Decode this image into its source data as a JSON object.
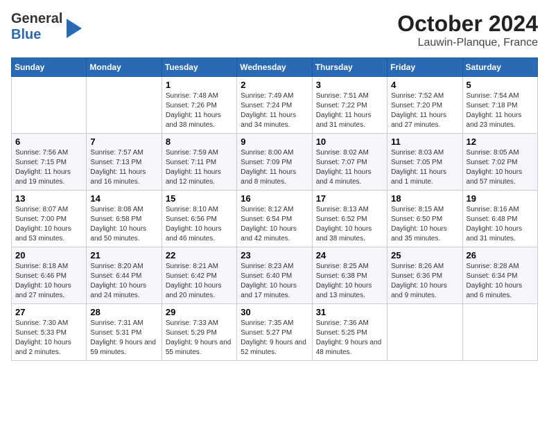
{
  "logo": {
    "general": "General",
    "blue": "Blue"
  },
  "title": "October 2024",
  "subtitle": "Lauwin-Planque, France",
  "days_of_week": [
    "Sunday",
    "Monday",
    "Tuesday",
    "Wednesday",
    "Thursday",
    "Friday",
    "Saturday"
  ],
  "weeks": [
    [
      {
        "day": "",
        "sunrise": "",
        "sunset": "",
        "daylight": ""
      },
      {
        "day": "",
        "sunrise": "",
        "sunset": "",
        "daylight": ""
      },
      {
        "day": "1",
        "sunrise": "Sunrise: 7:48 AM",
        "sunset": "Sunset: 7:26 PM",
        "daylight": "Daylight: 11 hours and 38 minutes."
      },
      {
        "day": "2",
        "sunrise": "Sunrise: 7:49 AM",
        "sunset": "Sunset: 7:24 PM",
        "daylight": "Daylight: 11 hours and 34 minutes."
      },
      {
        "day": "3",
        "sunrise": "Sunrise: 7:51 AM",
        "sunset": "Sunset: 7:22 PM",
        "daylight": "Daylight: 11 hours and 31 minutes."
      },
      {
        "day": "4",
        "sunrise": "Sunrise: 7:52 AM",
        "sunset": "Sunset: 7:20 PM",
        "daylight": "Daylight: 11 hours and 27 minutes."
      },
      {
        "day": "5",
        "sunrise": "Sunrise: 7:54 AM",
        "sunset": "Sunset: 7:18 PM",
        "daylight": "Daylight: 11 hours and 23 minutes."
      }
    ],
    [
      {
        "day": "6",
        "sunrise": "Sunrise: 7:56 AM",
        "sunset": "Sunset: 7:15 PM",
        "daylight": "Daylight: 11 hours and 19 minutes."
      },
      {
        "day": "7",
        "sunrise": "Sunrise: 7:57 AM",
        "sunset": "Sunset: 7:13 PM",
        "daylight": "Daylight: 11 hours and 16 minutes."
      },
      {
        "day": "8",
        "sunrise": "Sunrise: 7:59 AM",
        "sunset": "Sunset: 7:11 PM",
        "daylight": "Daylight: 11 hours and 12 minutes."
      },
      {
        "day": "9",
        "sunrise": "Sunrise: 8:00 AM",
        "sunset": "Sunset: 7:09 PM",
        "daylight": "Daylight: 11 hours and 8 minutes."
      },
      {
        "day": "10",
        "sunrise": "Sunrise: 8:02 AM",
        "sunset": "Sunset: 7:07 PM",
        "daylight": "Daylight: 11 hours and 4 minutes."
      },
      {
        "day": "11",
        "sunrise": "Sunrise: 8:03 AM",
        "sunset": "Sunset: 7:05 PM",
        "daylight": "Daylight: 11 hours and 1 minute."
      },
      {
        "day": "12",
        "sunrise": "Sunrise: 8:05 AM",
        "sunset": "Sunset: 7:02 PM",
        "daylight": "Daylight: 10 hours and 57 minutes."
      }
    ],
    [
      {
        "day": "13",
        "sunrise": "Sunrise: 8:07 AM",
        "sunset": "Sunset: 7:00 PM",
        "daylight": "Daylight: 10 hours and 53 minutes."
      },
      {
        "day": "14",
        "sunrise": "Sunrise: 8:08 AM",
        "sunset": "Sunset: 6:58 PM",
        "daylight": "Daylight: 10 hours and 50 minutes."
      },
      {
        "day": "15",
        "sunrise": "Sunrise: 8:10 AM",
        "sunset": "Sunset: 6:56 PM",
        "daylight": "Daylight: 10 hours and 46 minutes."
      },
      {
        "day": "16",
        "sunrise": "Sunrise: 8:12 AM",
        "sunset": "Sunset: 6:54 PM",
        "daylight": "Daylight: 10 hours and 42 minutes."
      },
      {
        "day": "17",
        "sunrise": "Sunrise: 8:13 AM",
        "sunset": "Sunset: 6:52 PM",
        "daylight": "Daylight: 10 hours and 38 minutes."
      },
      {
        "day": "18",
        "sunrise": "Sunrise: 8:15 AM",
        "sunset": "Sunset: 6:50 PM",
        "daylight": "Daylight: 10 hours and 35 minutes."
      },
      {
        "day": "19",
        "sunrise": "Sunrise: 8:16 AM",
        "sunset": "Sunset: 6:48 PM",
        "daylight": "Daylight: 10 hours and 31 minutes."
      }
    ],
    [
      {
        "day": "20",
        "sunrise": "Sunrise: 8:18 AM",
        "sunset": "Sunset: 6:46 PM",
        "daylight": "Daylight: 10 hours and 27 minutes."
      },
      {
        "day": "21",
        "sunrise": "Sunrise: 8:20 AM",
        "sunset": "Sunset: 6:44 PM",
        "daylight": "Daylight: 10 hours and 24 minutes."
      },
      {
        "day": "22",
        "sunrise": "Sunrise: 8:21 AM",
        "sunset": "Sunset: 6:42 PM",
        "daylight": "Daylight: 10 hours and 20 minutes."
      },
      {
        "day": "23",
        "sunrise": "Sunrise: 8:23 AM",
        "sunset": "Sunset: 6:40 PM",
        "daylight": "Daylight: 10 hours and 17 minutes."
      },
      {
        "day": "24",
        "sunrise": "Sunrise: 8:25 AM",
        "sunset": "Sunset: 6:38 PM",
        "daylight": "Daylight: 10 hours and 13 minutes."
      },
      {
        "day": "25",
        "sunrise": "Sunrise: 8:26 AM",
        "sunset": "Sunset: 6:36 PM",
        "daylight": "Daylight: 10 hours and 9 minutes."
      },
      {
        "day": "26",
        "sunrise": "Sunrise: 8:28 AM",
        "sunset": "Sunset: 6:34 PM",
        "daylight": "Daylight: 10 hours and 6 minutes."
      }
    ],
    [
      {
        "day": "27",
        "sunrise": "Sunrise: 7:30 AM",
        "sunset": "Sunset: 5:33 PM",
        "daylight": "Daylight: 10 hours and 2 minutes."
      },
      {
        "day": "28",
        "sunrise": "Sunrise: 7:31 AM",
        "sunset": "Sunset: 5:31 PM",
        "daylight": "Daylight: 9 hours and 59 minutes."
      },
      {
        "day": "29",
        "sunrise": "Sunrise: 7:33 AM",
        "sunset": "Sunset: 5:29 PM",
        "daylight": "Daylight: 9 hours and 55 minutes."
      },
      {
        "day": "30",
        "sunrise": "Sunrise: 7:35 AM",
        "sunset": "Sunset: 5:27 PM",
        "daylight": "Daylight: 9 hours and 52 minutes."
      },
      {
        "day": "31",
        "sunrise": "Sunrise: 7:36 AM",
        "sunset": "Sunset: 5:25 PM",
        "daylight": "Daylight: 9 hours and 48 minutes."
      },
      {
        "day": "",
        "sunrise": "",
        "sunset": "",
        "daylight": ""
      },
      {
        "day": "",
        "sunrise": "",
        "sunset": "",
        "daylight": ""
      }
    ]
  ]
}
